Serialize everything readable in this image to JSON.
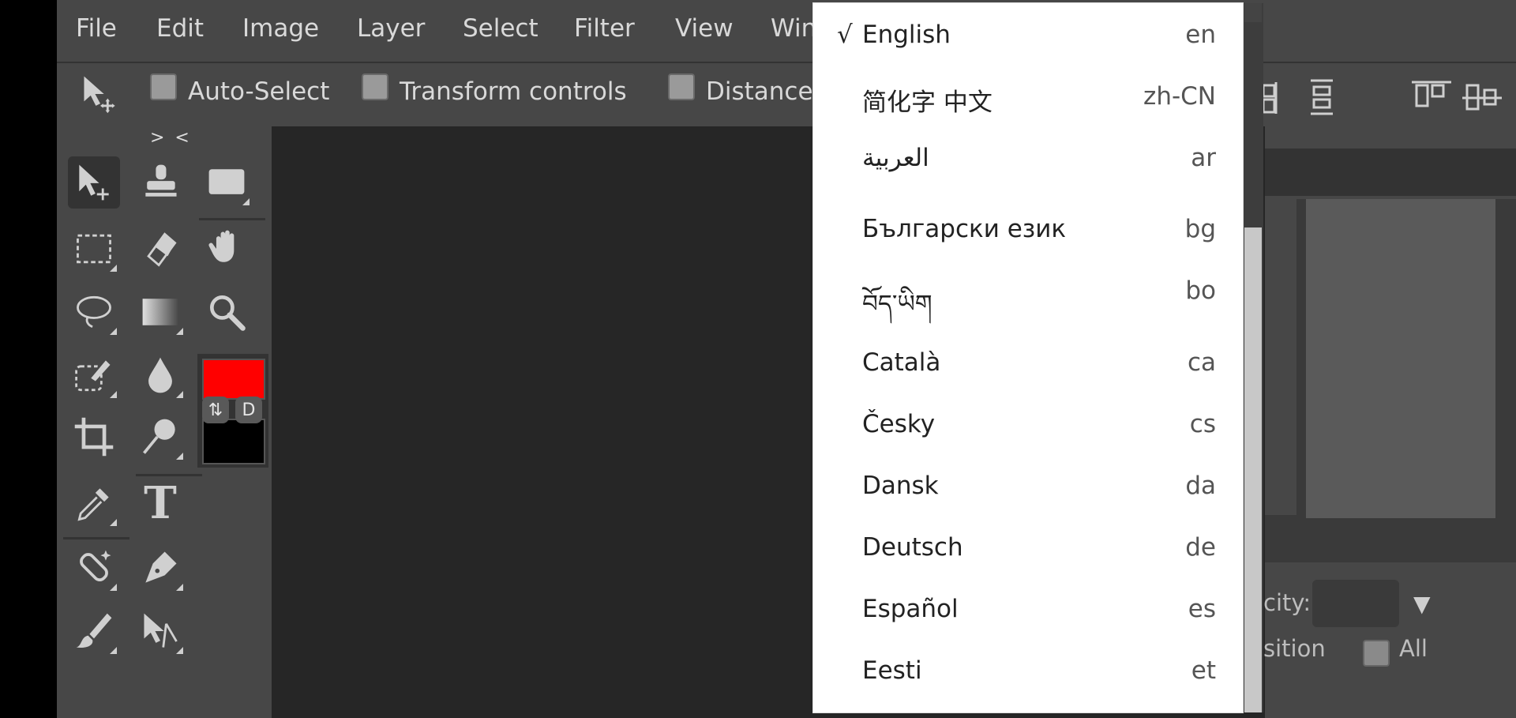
{
  "menubar": {
    "items": [
      "File",
      "Edit",
      "Image",
      "Layer",
      "Select",
      "Filter",
      "View",
      "Win"
    ]
  },
  "options": {
    "auto_select": "Auto-Select",
    "transform_controls": "Transform controls",
    "distances": "Distances"
  },
  "toolbox": {
    "collapse_label": "> <",
    "swap_label": "⇅",
    "default_label": "D",
    "foreground_color": "#ff0000",
    "background_color": "#000000",
    "type_tool_label": "T"
  },
  "right_panel": {
    "opacity_label": "city:",
    "position_label": "sition",
    "all_label": "All"
  },
  "language_menu": {
    "checkmark": "√",
    "items": [
      {
        "label": "English",
        "code": "en",
        "selected": true
      },
      {
        "label": "简化字 中文",
        "code": "zh-CN"
      },
      {
        "label": "العربية",
        "code": "ar"
      },
      {
        "label": "Български език",
        "code": "bg"
      },
      {
        "label": "བོད་ཡིག",
        "code": "bo"
      },
      {
        "label": "Català",
        "code": "ca"
      },
      {
        "label": "Česky",
        "code": "cs"
      },
      {
        "label": "Dansk",
        "code": "da"
      },
      {
        "label": "Deutsch",
        "code": "de"
      },
      {
        "label": "Español",
        "code": "es"
      },
      {
        "label": "Eesti",
        "code": "et"
      }
    ]
  }
}
